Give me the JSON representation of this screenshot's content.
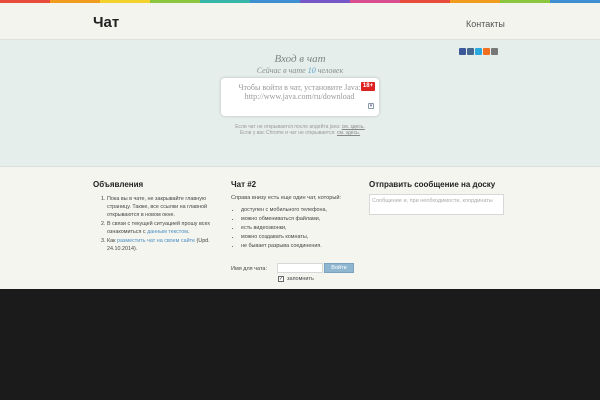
{
  "colors": {
    "stripe": [
      "#e94b3c",
      "#f29c1f",
      "#f2d22b",
      "#8cc63e",
      "#36b6a9",
      "#3d8fd1",
      "#7557c8",
      "#d94d91",
      "#e94b3c",
      "#f29c1f",
      "#8cc63e",
      "#3d8fd1"
    ],
    "share": [
      "#3b5998",
      "#45668e",
      "#2aa9e0",
      "#f26f21",
      "#777777"
    ],
    "accent_link": "#4b8ec2",
    "badge": "#dd2222"
  },
  "header": {
    "logo": "Чат",
    "nav_contacts": "Контакты"
  },
  "login": {
    "title": "Вход в чат",
    "sub_prefix": "Сейчас в чате",
    "online_count": "10",
    "sub_suffix": "человек",
    "java_message": "Чтобы войти в чат, установите Java: http://www.java.com/ru/download",
    "age_badge": "18+",
    "help1_text": "Если чат не открывается после апдейта java:",
    "help1_link": "см. здесь.",
    "help2_text": "Если у вас Chrome и чат не открывается:",
    "help2_link": "см. здесь."
  },
  "announcements": {
    "title": "Объявления",
    "item1": "Пока вы в чате, не закрывайте главную страницу. Также, все ссылки на главной открываются в новом окне.",
    "item2_text": "В связи с текущей ситуацией прошу всех ознакомиться с",
    "item2_link": "данным текстом",
    "item2_end": ".",
    "item3_text": "Как",
    "item3_link": "разместить чат на своем сайте",
    "item3_end": "(Upd. 24.10.2014)."
  },
  "chat2": {
    "title": "Чат #2",
    "intro": "Справа внизу есть еще один чат, который:",
    "features": [
      "доступен с мобильного телефона,",
      "можно обмениваться файлами,",
      "есть видеозвонки,",
      "можно создавать комнаты,",
      "не бывает разрыва соединения."
    ],
    "name_label": "Имя для чата:",
    "login_button": "Войти",
    "remember_label": "запомнить"
  },
  "send_message": {
    "title": "Отправить сообщение на доску",
    "placeholder": "Сообщение и, при необходимости, координаты"
  }
}
